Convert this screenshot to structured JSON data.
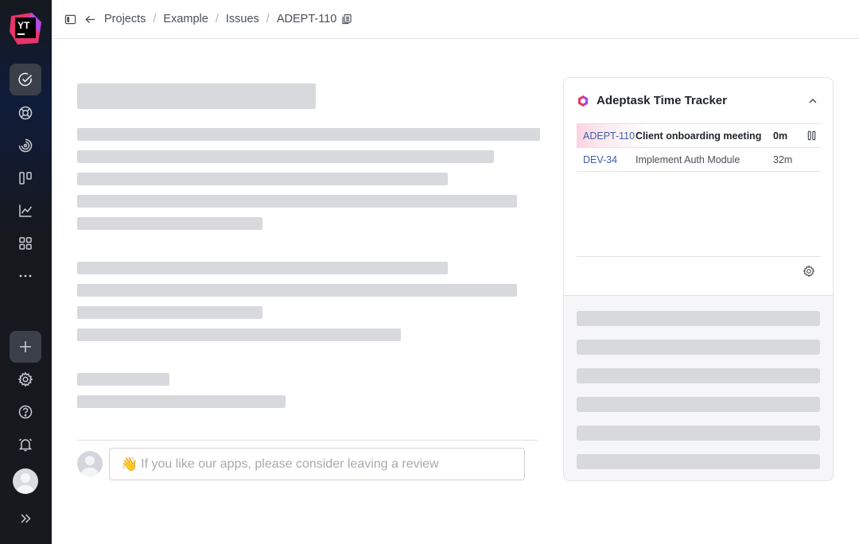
{
  "app": {
    "logo_text": "YT"
  },
  "sidebar": {
    "items": [
      {
        "name": "issues",
        "icon": "check-circle-icon",
        "active": true
      },
      {
        "name": "helpdesk",
        "icon": "lifebuoy-icon"
      },
      {
        "name": "agile",
        "icon": "spiral-icon"
      },
      {
        "name": "boards",
        "icon": "board-icon"
      },
      {
        "name": "reports",
        "icon": "chart-icon"
      },
      {
        "name": "apps",
        "icon": "grid-icon"
      },
      {
        "name": "more",
        "icon": "more-icon"
      }
    ]
  },
  "breadcrumb": {
    "items": [
      "Projects",
      "Example",
      "Issues",
      "ADEPT-110"
    ],
    "separator": "/"
  },
  "review": {
    "emoji": "👋",
    "placeholder": "If you like our apps, please consider leaving a review"
  },
  "widget": {
    "title": "Adeptask Time Tracker",
    "rows": [
      {
        "id": "ADEPT-110",
        "summary": "Client onboarding meeting",
        "time": "0m",
        "active": true
      },
      {
        "id": "DEV-34",
        "summary": "Implement Auth Module",
        "time": "32m",
        "active": false
      }
    ]
  },
  "colors": {
    "accent": "#3e5ea8",
    "brand_pink": "#e8336b"
  }
}
